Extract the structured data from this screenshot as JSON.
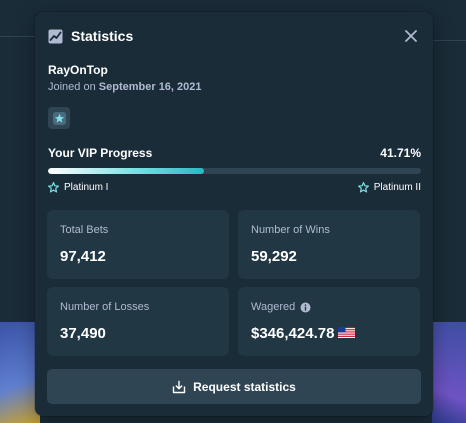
{
  "modal": {
    "title": "Statistics",
    "title_icon": "chart-line-icon",
    "close_icon": "close-icon"
  },
  "user": {
    "username": "RayOnTop",
    "joined_prefix": "Joined on",
    "joined_date": "September 16, 2021",
    "badge_icon": "vip-star-badge-icon"
  },
  "vip": {
    "label": "Your VIP Progress",
    "percent_text": "41.71%",
    "progress": 0.4171,
    "current_rank": "Platinum I",
    "next_rank": "Platinum II",
    "rank_icon": "star-icon"
  },
  "stats": [
    {
      "label": "Total Bets",
      "value": "97,412"
    },
    {
      "label": "Number of Wins",
      "value": "59,292"
    },
    {
      "label": "Number of Losses",
      "value": "37,490"
    },
    {
      "label": "Wagered",
      "value": "$346,424.78",
      "info_icon": "info-icon",
      "currency_icon": "us-flag-icon"
    }
  ],
  "actions": {
    "request_label": "Request statistics",
    "request_icon": "download-tray-icon"
  },
  "colors": {
    "background": "#0f212e",
    "modal": "#1a2c38",
    "card": "#213743",
    "muted_text": "#b1bad3",
    "accent": "#2bb8c4",
    "button": "#2f4553"
  }
}
